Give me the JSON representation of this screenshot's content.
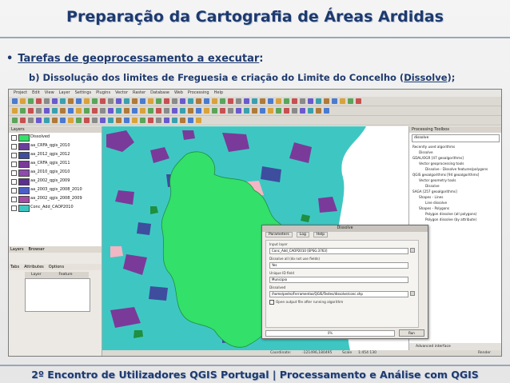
{
  "slide": {
    "title": "Preparação da Cartografia de Áreas Ardidas",
    "bullet_main": "Tarefas de geoprocessamento a executar",
    "bullet_main_suffix": ":",
    "bullet_sub_prefix": "b) Dissolução dos limites de Freguesia e criação do Limite do Concelho (",
    "bullet_sub_link": "Dissolve",
    "bullet_sub_suffix": ");",
    "footer": "2º Encontro de Utilizadores QGIS Portugal  |  Processamento e Análise com QGIS"
  },
  "qgis": {
    "menu": [
      "Project",
      "Edit",
      "View",
      "Layer",
      "Settings",
      "Plugins",
      "Vector",
      "Raster",
      "Database",
      "Web",
      "Processing",
      "Help"
    ],
    "layers_panel_title": "Layers",
    "layers": [
      {
        "name": "Dissolved",
        "color": "#33e06a"
      },
      {
        "name": "aa_CRFA_qgis_2010",
        "color": "#6a3f9c"
      },
      {
        "name": "aa_2012_qgis_2012",
        "color": "#3e4d9e"
      },
      {
        "name": "aa_CRFA_qgis_2011",
        "color": "#7a3a9a"
      },
      {
        "name": "aa_2010_qgis_2010",
        "color": "#8f4bb0"
      },
      {
        "name": "aa_2002_qgis_2009",
        "color": "#5a2f8e"
      },
      {
        "name": "aa_2003_qgis_2008_2010",
        "color": "#4a5ec8"
      },
      {
        "name": "aa_2002_qgis_2008_2009",
        "color": "#a64ba8"
      },
      {
        "name": "Conc_Add_CAOP2010",
        "color": "#3ec7c2"
      }
    ],
    "lower_tabs": [
      "Layers",
      "Browser"
    ],
    "attr_tabs": [
      "Tabs",
      "Attributes",
      "Options"
    ],
    "attr_columns": [
      "Layer",
      "Feature"
    ],
    "toolbox_title": "Processing Toolbox",
    "toolbox_search": "dissolve",
    "toolbox_tree": [
      "Recently used algorithms",
      "Dissolve",
      "GDAL/OGR [47 geoalgorithms]",
      "Vector geoprocessing tools",
      "Dissolve - Dissolve features/polygons",
      "QGIS geoalgorithms [94 geoalgorithms]",
      "Vector geometry tools",
      "Dissolve",
      "SAGA [257 geoalgorithms]",
      "Shapes - Lines",
      "Line dissolve",
      "Shapes - Polygons",
      "Polygon dissolve (all polygons)",
      "Polygon dissolve (by attribute)"
    ],
    "toolbox_footer": "Advanced interface",
    "dialog_title": "Dissolve",
    "dialog_tabs": [
      "Parameters",
      "Log",
      "Help"
    ],
    "dialog_fields": [
      {
        "label": "Input layer",
        "value": "Conc_Add_CAOP2010 [EPSG:3763]"
      },
      {
        "label": "Dissolve all (do not use fields)",
        "value": "Yes"
      },
      {
        "label": "Unique ID field",
        "value": "Municipio"
      },
      {
        "label": "Dissolved",
        "value": "/home/pedro/Ferramentas/QGIS/Testes/dissolve/conc.shp"
      }
    ],
    "dialog_check": "Open output file after running algorithm",
    "dialog_progress": "0%",
    "dialog_run": "Run",
    "status": {
      "coordinate_label": "Coordinate:",
      "coordinate": "-121496,180495",
      "scale_label": "Scale",
      "scale": "1:454 130",
      "render": "Render"
    }
  }
}
